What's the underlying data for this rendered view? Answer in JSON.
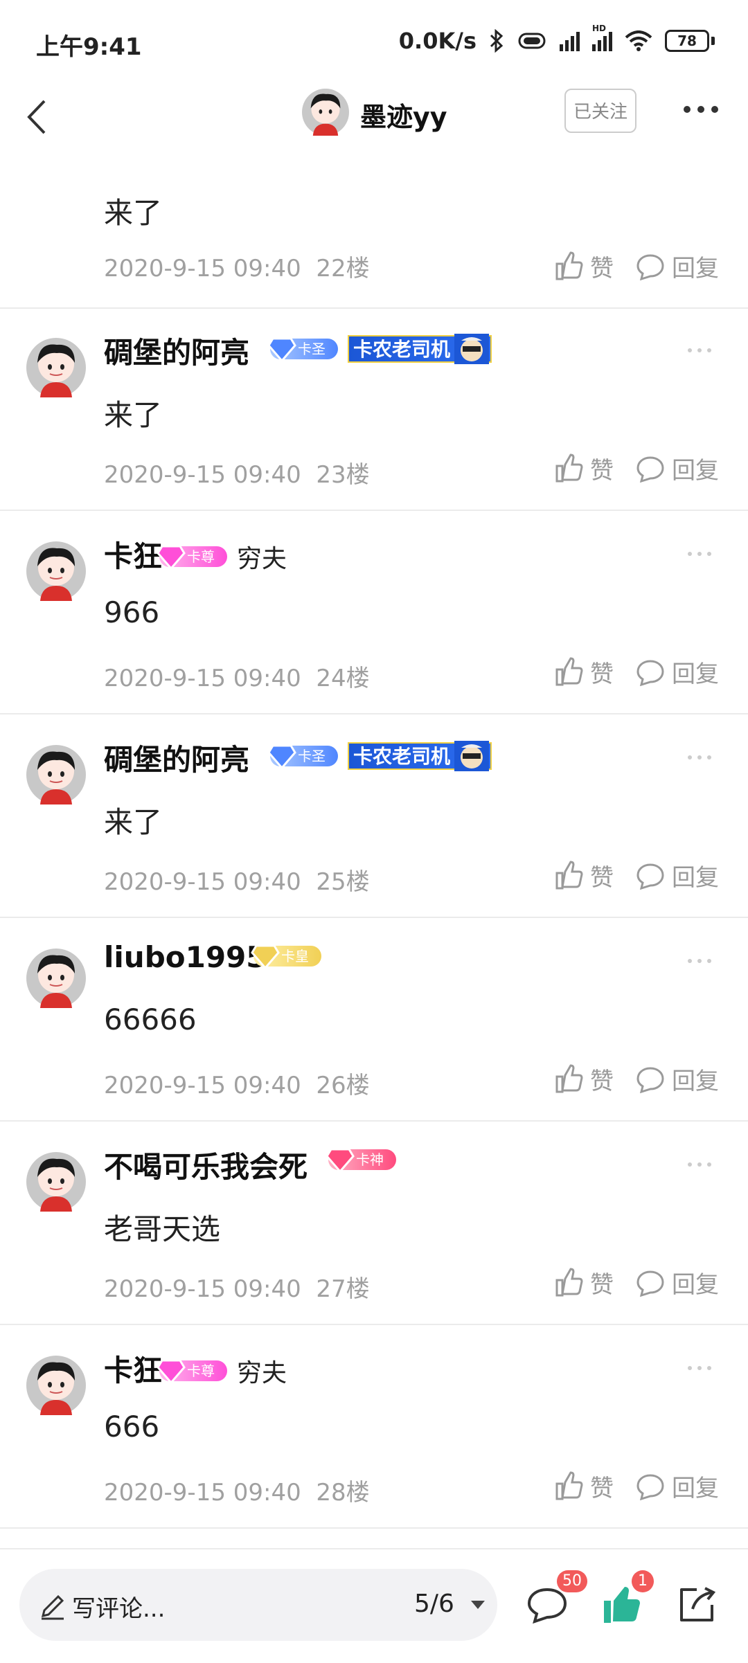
{
  "status_bar": {
    "time": "上午9:41",
    "speed": "0.0K/s",
    "network_hd": "HD",
    "battery": "78"
  },
  "header": {
    "user_name": "墨迹yy",
    "follow_label": "已关注"
  },
  "top_partial": {
    "text": "来了",
    "date": "2020-9-15 09:40",
    "floor": "22楼"
  },
  "comments": [
    {
      "name": "碉堡的阿亮",
      "badge": "卡圣",
      "badge_color": "#4f86ff",
      "title_badge": "卡农老司机",
      "plain_badge": "",
      "text": "来了",
      "date": "2020-9-15 09:40",
      "floor": "23楼"
    },
    {
      "name": "卡狂",
      "badge": "卡尊",
      "badge_color": "#ff4fd8",
      "title_badge": "",
      "plain_badge": "穷夫",
      "text": "966",
      "date": "2020-9-15 09:40",
      "floor": "24楼"
    },
    {
      "name": "碉堡的阿亮",
      "badge": "卡圣",
      "badge_color": "#4f86ff",
      "title_badge": "卡农老司机",
      "plain_badge": "",
      "text": "来了",
      "date": "2020-9-15 09:40",
      "floor": "25楼"
    },
    {
      "name": "liubo1995",
      "badge": "卡皇",
      "badge_color": "#f1d055",
      "title_badge": "",
      "plain_badge": "",
      "text": "66666",
      "date": "2020-9-15 09:40",
      "floor": "26楼"
    },
    {
      "name": "不喝可乐我会死",
      "badge": "卡神",
      "badge_color": "#ff4b7e",
      "title_badge": "",
      "plain_badge": "",
      "text": "老哥天选",
      "date": "2020-9-15 09:40",
      "floor": "27楼"
    },
    {
      "name": "卡狂",
      "badge": "卡尊",
      "badge_color": "#ff4fd8",
      "title_badge": "",
      "plain_badge": "穷夫",
      "text": "666",
      "date": "2020-9-15 09:40",
      "floor": "28楼"
    }
  ],
  "actions": {
    "like_label": "赞",
    "reply_label": "回复"
  },
  "bottom_bar": {
    "placeholder": "写评论...",
    "page_indicator": "5/6",
    "comment_count": "50",
    "like_count": "1"
  },
  "icons": [
    "back-icon",
    "more-icon",
    "like-icon",
    "reply-icon",
    "pen-icon",
    "comment-icon",
    "thumb-icon",
    "share-icon"
  ]
}
